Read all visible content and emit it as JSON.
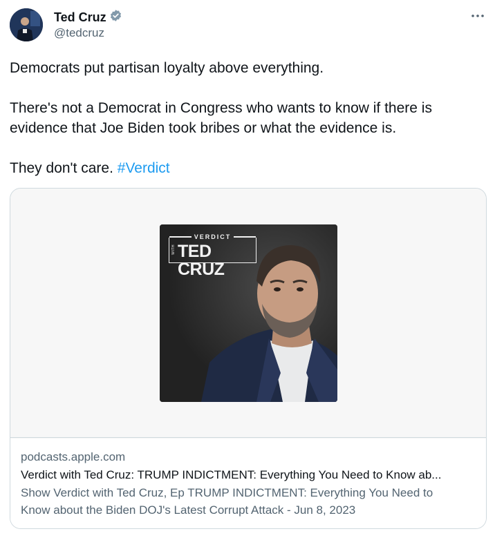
{
  "author": {
    "name": "Ted Cruz",
    "handle": "@tedcruz",
    "verified_icon": "verified-badge-icon",
    "avatar_bg": "#1d2f4e"
  },
  "menu": {
    "icon": "more-horizontal-icon"
  },
  "tweet": {
    "line1": "Democrats put partisan loyalty above everything.",
    "line2a": "There's not a Democrat in Congress who wants to know if there is",
    "line2b": "evidence that Joe Biden took bribes or what the evidence is.",
    "line3_text": "They don't care. ",
    "hashtag": "#Verdict",
    "hashtag_color": "#1d9bf0"
  },
  "card": {
    "cover_logo_small": "VERDICT",
    "cover_logo_with": "WITH",
    "cover_logo_big": "TED CRUZ",
    "domain": "podcasts.apple.com",
    "title": "Verdict with Ted Cruz: TRUMP INDICTMENT: Everything You Need to Know ab...",
    "description_line1": "Show Verdict with Ted Cruz, Ep TRUMP INDICTMENT: Everything You Need to",
    "description_line2": "Know about the Biden DOJ's Latest Corrupt Attack - Jun 8, 2023"
  }
}
